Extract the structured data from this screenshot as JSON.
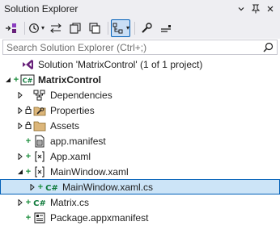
{
  "window": {
    "title": "Solution Explorer",
    "actions": {
      "dropdown_icon": "chevron-down-icon",
      "pin_icon": "pin-icon",
      "close_icon": "close-icon"
    }
  },
  "toolbar": {
    "tools": [
      {
        "name": "switch-views-icon"
      },
      {
        "name": "pending-changes-filter-icon",
        "dropdown": true
      },
      {
        "name": "sync-with-active-document-icon"
      },
      {
        "name": "refresh-icon"
      },
      {
        "name": "collapse-all-icon"
      },
      {
        "name": "show-all-files-icon",
        "active": true,
        "dropdown": true
      },
      {
        "name": "properties-icon"
      },
      {
        "name": "preview-selected-items-icon"
      }
    ]
  },
  "search": {
    "placeholder": "Search Solution Explorer (Ctrl+;)"
  },
  "tree": {
    "items": [
      {
        "label": "Solution 'MatrixControl' (1 of 1 project)",
        "icon": "solution-icon",
        "depth": 0,
        "expander": "none",
        "badge": ""
      },
      {
        "label": "MatrixControl",
        "icon": "csharp-project-icon",
        "depth": 0,
        "expander": "expanded",
        "badge": "plus",
        "bold": true
      },
      {
        "label": "Dependencies",
        "icon": "dependencies-icon",
        "depth": 1,
        "expander": "collapsed",
        "badge": ""
      },
      {
        "label": "Properties",
        "icon": "properties-folder-icon",
        "depth": 1,
        "expander": "collapsed",
        "badge": "lock"
      },
      {
        "label": "Assets",
        "icon": "folder-icon",
        "depth": 1,
        "expander": "collapsed",
        "badge": "lock"
      },
      {
        "label": "app.manifest",
        "icon": "manifest-file-icon",
        "depth": 1,
        "expander": "none",
        "badge": "plus"
      },
      {
        "label": "App.xaml",
        "icon": "xaml-file-icon",
        "depth": 1,
        "expander": "collapsed",
        "badge": "plus"
      },
      {
        "label": "MainWindow.xaml",
        "icon": "xaml-file-icon",
        "depth": 1,
        "expander": "expanded",
        "badge": "plus"
      },
      {
        "label": "MainWindow.xaml.cs",
        "icon": "csharp-file-icon",
        "depth": 2,
        "expander": "collapsed",
        "badge": "plus",
        "selected": true
      },
      {
        "label": "Matrix.cs",
        "icon": "csharp-file-icon",
        "depth": 1,
        "expander": "collapsed",
        "badge": "plus"
      },
      {
        "label": "Package.appxmanifest",
        "icon": "appx-manifest-icon",
        "depth": 1,
        "expander": "none",
        "badge": "plus"
      }
    ]
  },
  "colors": {
    "accent": "#005fb8",
    "selection": "#cce4f7",
    "chrome": "#eeeef2",
    "csharp": "#0f7a3b",
    "add_badge": "#1e8f3e",
    "folder": "#dcb67a",
    "solution": "#68217a"
  }
}
